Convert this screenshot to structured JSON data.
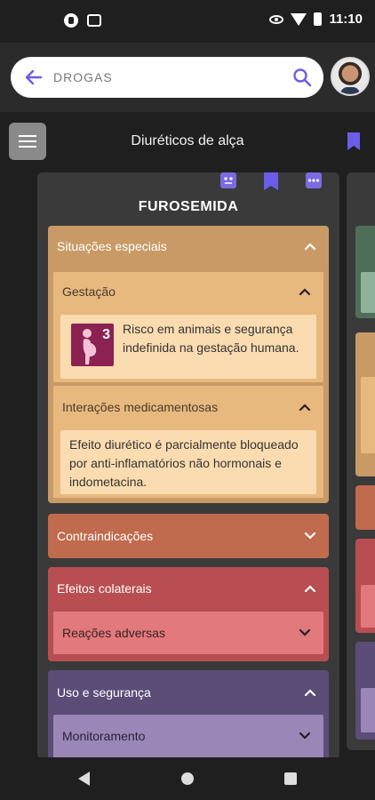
{
  "status_bar": {
    "time": "11:10"
  },
  "search": {
    "placeholder": "DROGAS"
  },
  "header": {
    "title": "Diuréticos de alça"
  },
  "card": {
    "title": "FUROSEMIDA",
    "sections": {
      "special": {
        "label": "Situações especiais",
        "gestation": {
          "label": "Gestação",
          "risk_category": "3",
          "text": "Risco em animais e segurança indefinida na gestação humana."
        },
        "interactions": {
          "label": "Interações medicamentosas",
          "text": "Efeito diurético é parcialmente bloqueado por anti-inflamatórios não hormonais e indometacina."
        }
      },
      "contraindications": {
        "label": "Contraindicações"
      },
      "side_effects": {
        "label": "Efeitos colaterais",
        "adverse": {
          "label": "Reações adversas"
        }
      },
      "usage": {
        "label": "Uso e segurança",
        "monitoring": {
          "label": "Monitoramento"
        }
      }
    }
  },
  "colors": {
    "special": "#c99a66",
    "special_sub": "#e8b97f",
    "special_body": "#fbdcb0",
    "contraindications": "#c06a4e",
    "side_effects": "#b84e52",
    "side_effects_sub": "#e2797c",
    "usage": "#5b4c78",
    "usage_sub": "#9b86b8",
    "accent": "#6c5ce7"
  }
}
